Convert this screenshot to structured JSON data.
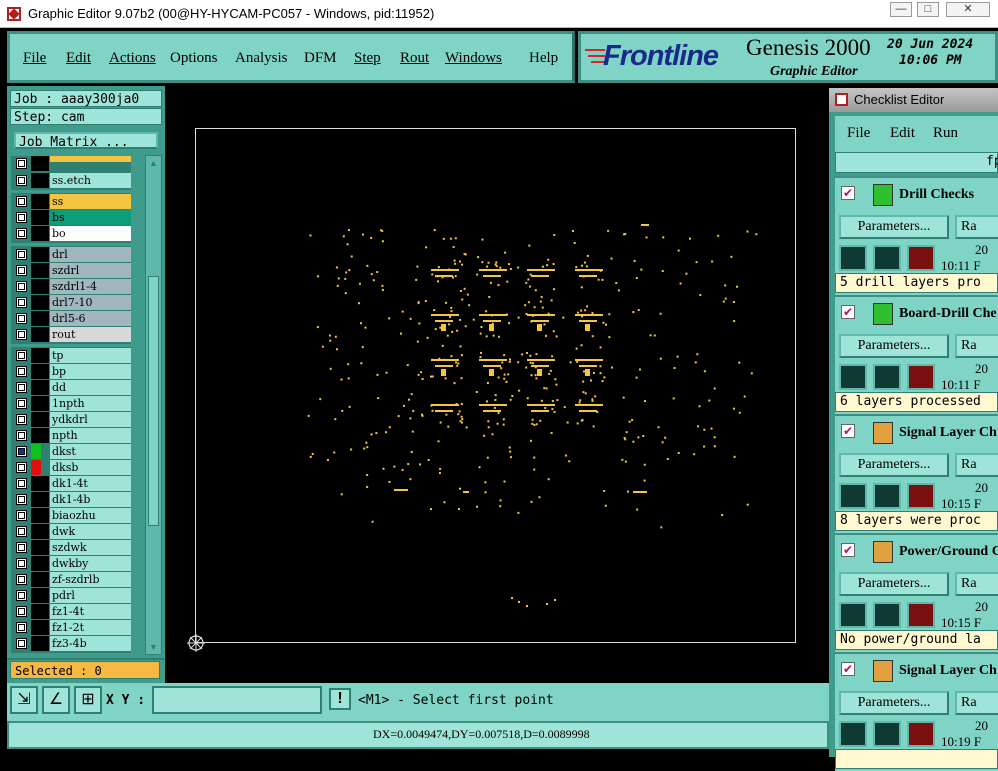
{
  "window": {
    "title": "Graphic Editor 9.07b2 (00@HY-HYCAM-PC057 - Windows, pid:11952)"
  },
  "menus": [
    "File",
    "Edit",
    "Actions",
    "Options",
    "Analysis",
    "DFM",
    "Step",
    "Rout",
    "Windows",
    "Help"
  ],
  "brand": {
    "logo": "Frontline",
    "product": "Genesis 2000",
    "subtitle": "Graphic Editor",
    "date": "20 Jun 2024",
    "time": "10:06 PM"
  },
  "job": {
    "job_label": "Job : aaay300ja0",
    "step_label": "Step: cam",
    "matrix_button": "Job Matrix ..."
  },
  "layers": {
    "g1": [
      {
        "name": "",
        "color": "#f5c542"
      },
      {
        "name": "ss.etch",
        "color": "#9fe4d8"
      }
    ],
    "g2": [
      {
        "name": "ss",
        "color": "#f5c542"
      },
      {
        "name": "bs",
        "color": "#0f9c78"
      },
      {
        "name": "bo",
        "color": "#ffffff"
      }
    ],
    "g3": [
      {
        "name": "drl",
        "color": "#9fb7bd"
      },
      {
        "name": "szdrl",
        "color": "#9fb7bd"
      },
      {
        "name": "szdrl1-4",
        "color": "#9fb7bd"
      },
      {
        "name": "drl7-10",
        "color": "#9fb7bd"
      },
      {
        "name": "drl5-6",
        "color": "#9fb7bd"
      },
      {
        "name": "rout",
        "color": "#d8d8d8"
      }
    ],
    "g4": [
      "tp",
      "bp",
      "dd",
      "1npth",
      "ydkdrl",
      "npth",
      "dkst",
      "dksb",
      "dk1-4t",
      "dk1-4b",
      "biaozhu",
      "dwk",
      "szdwk",
      "dwkby",
      "zf-szdrlb",
      "pdrl",
      "fz1-4t",
      "fz1-2t",
      "fz3-4b"
    ]
  },
  "selected": "Selected : 0",
  "status": {
    "xy_label": "X Y :",
    "xy_value": "",
    "prompt": "<M1> - Select first point",
    "measure": "DX=0.0049474,DY=0.007518,D=0.0089998"
  },
  "checklist": {
    "title": "Checklist Editor",
    "menus": [
      "File",
      "Edit",
      "Run"
    ],
    "header_fragment": "fp",
    "sections": [
      {
        "name": "Drill Checks",
        "params": "Parameters...",
        "run": "Ra",
        "date": "20",
        "time": "10:11 F",
        "msg": "5 drill layers pro"
      },
      {
        "name": "Board-Drill Che",
        "params": "Parameters...",
        "run": "Ra",
        "date": "20",
        "time": "10:11 F",
        "msg": "6 layers processed"
      },
      {
        "name": "Signal Layer Ch",
        "params": "Parameters...",
        "run": "Ra",
        "date": "20",
        "time": "10:15 F",
        "msg": "8 layers were proc"
      },
      {
        "name": "Power/Ground C",
        "params": "Parameters...",
        "run": "Ra",
        "date": "20",
        "time": "10:15 F",
        "msg": "No power/ground la"
      },
      {
        "name": "Signal Layer Ch",
        "params": "Parameters...",
        "run": "Ra",
        "date": "20",
        "time": "10:19 F",
        "msg": ""
      }
    ]
  },
  "colors": {
    "panel": "#7fd4c6",
    "accent": "#3f8e81",
    "feature": "#f5c542",
    "canvas": "#000000"
  }
}
